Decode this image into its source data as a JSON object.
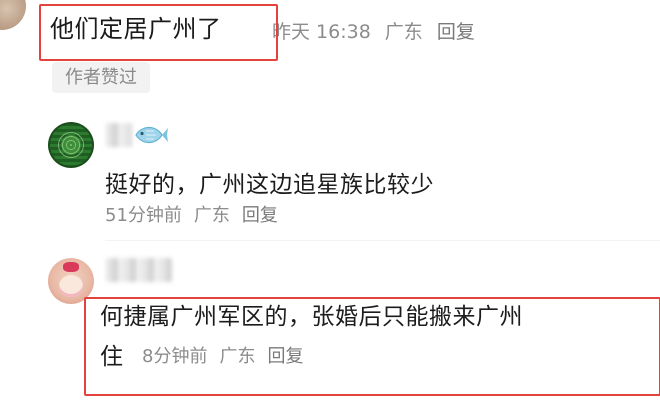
{
  "main_comment": {
    "text": "他们定居广州了",
    "time": "昨天 16:38",
    "location": "广东",
    "reply_label": "回复",
    "author_liked": "作者赞过"
  },
  "replies": [
    {
      "text": "挺好的，广州这边追星族比较少",
      "time": "51分钟前",
      "location": "广东",
      "reply_label": "回复"
    },
    {
      "text_line1": "何捷属广州军区的，张婚后只能搬来广州",
      "text_line2": "住",
      "time": "8分钟前",
      "location": "广东",
      "reply_label": "回复"
    }
  ],
  "colors": {
    "highlight_border": "#e4433d",
    "meta_text": "#8c8c8c",
    "body_text": "#1c1c1c"
  },
  "icons": {
    "user_badge": "fish-icon"
  }
}
